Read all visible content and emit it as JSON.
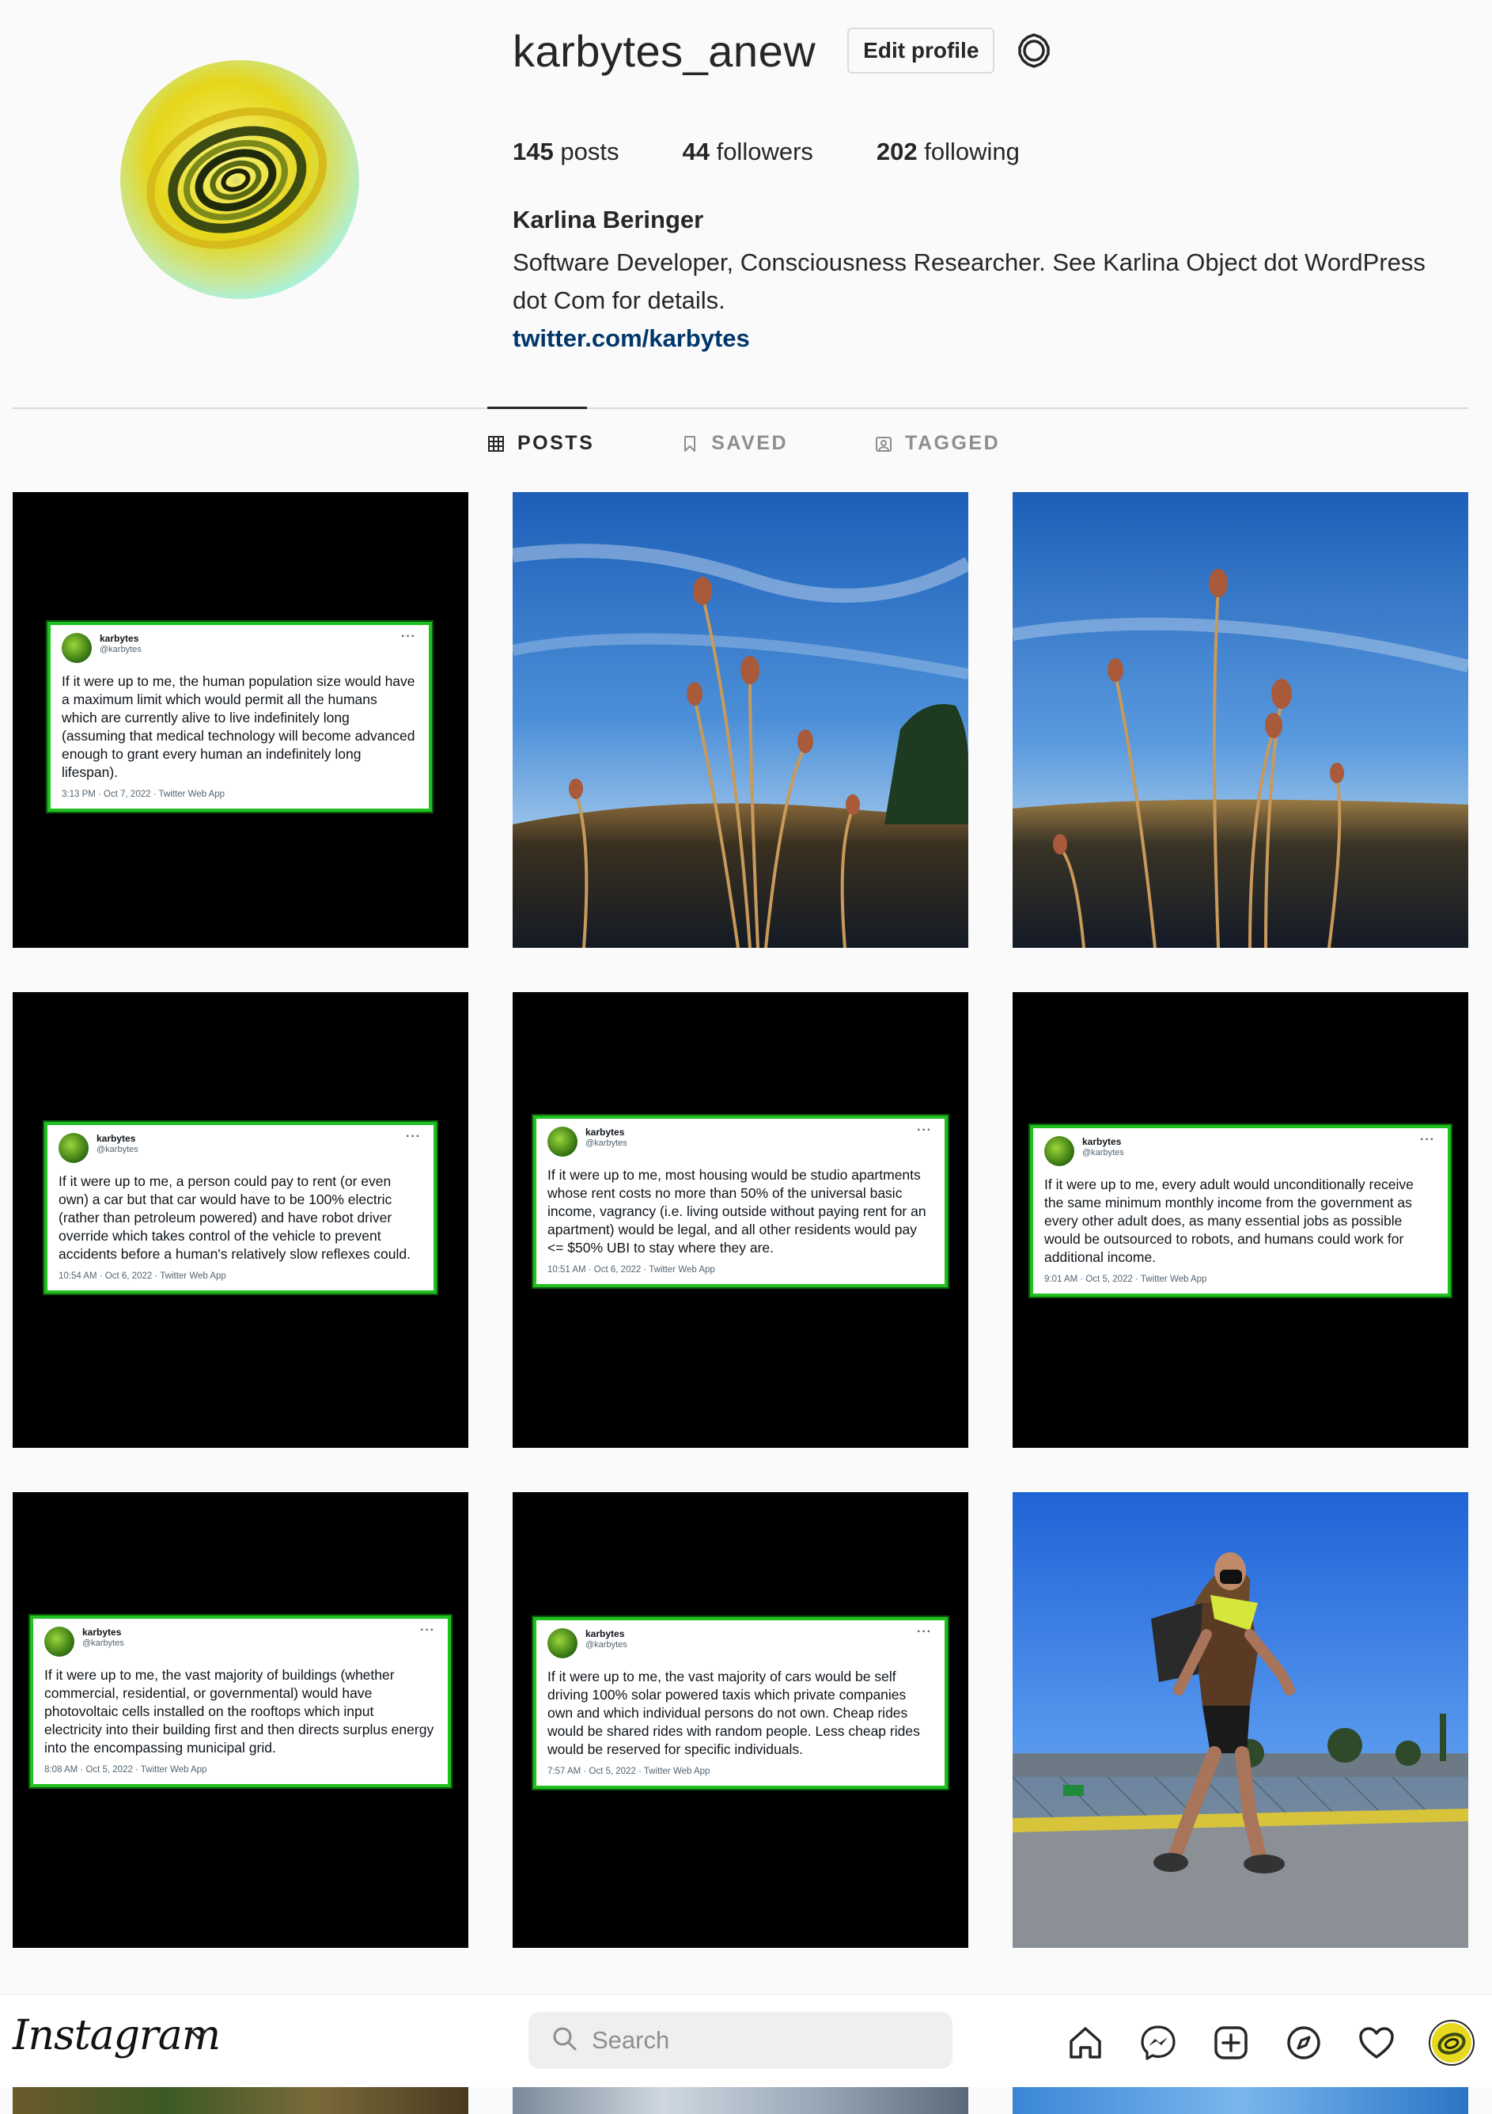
{
  "profile": {
    "username": "karbytes_anew",
    "edit_label": "Edit profile",
    "settings_icon": "gear-icon",
    "posts_count": "145",
    "posts_label": "posts",
    "followers_count": "44",
    "followers_label": "followers",
    "following_count": "202",
    "following_label": "following",
    "full_name": "Karlina Beringer",
    "bio_line1": "Software Developer, Consciousness Researcher. See Karlina Object dot WordPress",
    "bio_line2": "dot Com for details.",
    "link": "twitter.com/karbytes"
  },
  "tabs": [
    {
      "label": "POSTS",
      "icon": "grid-icon",
      "active": true
    },
    {
      "label": "SAVED",
      "icon": "bookmark-icon",
      "active": false
    },
    {
      "label": "TAGGED",
      "icon": "tag-icon",
      "active": false
    }
  ],
  "tweets": [
    {
      "name": "karbytes",
      "handle": "@karbytes",
      "more": "···",
      "text": "If it were up to me, the human population size would have a maximum limit which would permit all the humans which are currently alive to live indefinitely long (assuming that medical technology will become advanced enough to grant every human an indefinitely long lifespan).",
      "meta": "3:13 PM · Oct 7, 2022 · Twitter Web App"
    },
    {
      "name": "karbytes",
      "handle": "@karbytes",
      "more": "···",
      "text": "If it were up to me, a person could pay to rent (or even own) a car but that car would have to be 100% electric (rather than petroleum powered) and have robot driver override which takes control of the vehicle to prevent accidents before a human's relatively slow reflexes could.",
      "meta": "10:54 AM · Oct 6, 2022 · Twitter Web App"
    },
    {
      "name": "karbytes",
      "handle": "@karbytes",
      "more": "···",
      "text": "If it were up to me, most housing would be studio apartments whose rent costs no more than 50% of the universal basic income, vagrancy (i.e. living outside without paying rent for an apartment) would be legal, and all other residents would pay <= $50% UBI to stay where they are.",
      "meta": "10:51 AM · Oct 6, 2022 · Twitter Web App"
    },
    {
      "name": "karbytes",
      "handle": "@karbytes",
      "more": "···",
      "text": "If it were up to me, every adult would unconditionally receive the same minimum monthly income from the government as every other adult does, as many essential jobs as possible would be outsourced to robots, and humans could work for additional income.",
      "meta": "9:01 AM · Oct 5, 2022 · Twitter Web App"
    },
    {
      "name": "karbytes",
      "handle": "@karbytes",
      "more": "···",
      "text": "If it were up to me, the vast majority of buildings (whether commercial, residential, or governmental) would have photovoltaic cells installed on the rooftops which input electricity into their building first and then directs surplus energy into the encompassing municipal grid.",
      "meta": "8:08 AM · Oct 5, 2022 · Twitter Web App"
    },
    {
      "name": "karbytes",
      "handle": "@karbytes",
      "more": "···",
      "text": "If it were up to me, the vast majority of cars would be self driving 100% solar powered taxis which private companies own and which individual persons do not own. Cheap rides would be shared rides with random people. Less cheap rides would be reserved for specific individuals.",
      "meta": "7:57 AM · Oct 5, 2022 · Twitter Web App"
    }
  ],
  "nav": {
    "logo": "Instagram",
    "search_placeholder": "Search",
    "icons": [
      "home-icon",
      "messenger-icon",
      "new-post-icon",
      "explore-icon",
      "heart-icon",
      "profile-avatar"
    ]
  },
  "colors": {
    "link": "#00376b",
    "tweet_border": "#20c020",
    "muted": "#8e8e8e"
  }
}
